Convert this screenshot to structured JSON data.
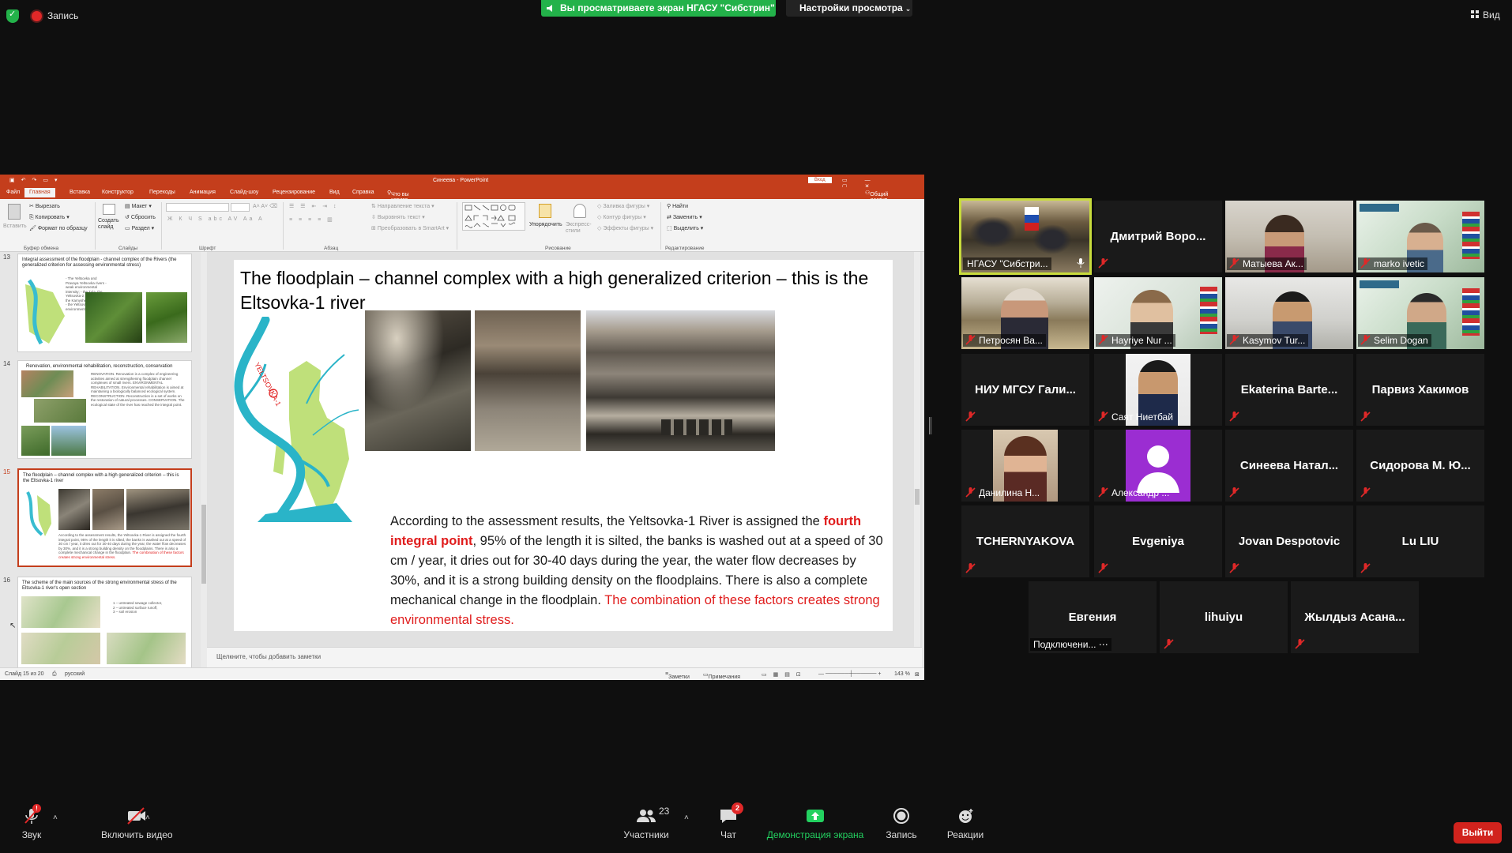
{
  "topbar": {
    "record_label": "Запись",
    "share_banner": "Вы просматриваете экран НГАСУ \"Сибстрин\"",
    "view_options": "Настройки просмотра",
    "view_button": "Вид"
  },
  "ppt": {
    "title": "Синеева - PowerPoint",
    "signin": "Вход",
    "tabs": [
      "Файл",
      "Главная",
      "Вставка",
      "Конструктор",
      "Переходы",
      "Анимация",
      "Слайд-шоу",
      "Рецензирование",
      "Вид",
      "Справка"
    ],
    "tell_me": "Что вы хотите сделать?",
    "share": "Общий доступ",
    "ribbon": {
      "paste": "Вставить",
      "cut": "Вырезать",
      "copy": "Копировать",
      "format_painter": "Формат по образцу",
      "clipboard": "Буфер обмена",
      "new_slide": "Создать слайд",
      "layout": "Макет",
      "reset": "Сбросить",
      "section": "Раздел",
      "slides": "Слайды",
      "font": "Шрифт",
      "paragraph": "Абзац",
      "text_direction": "Направление текста",
      "align_text": "Выровнять текст",
      "smartart": "Преобразовать в SmartArt",
      "arrange": "Упорядочить",
      "quick_styles": "Экспресс-стили",
      "shape_fill": "Заливка фигуры",
      "shape_outline": "Контур фигуры",
      "shape_effects": "Эффекты фигуры",
      "drawing": "Рисование",
      "find": "Найти",
      "replace": "Заменить",
      "select": "Выделить",
      "editing": "Редактирование"
    },
    "thumbnails": [
      {
        "num": "13",
        "title": "Integral assessment of the floodplain - channel complex of the Rivers (the generalized criterion for assessing environmental stress)",
        "text": "- The Yeltsovka and Pravaya Yeltsovka rivers - weak environmental intensity; - the Tula, the Yeltsovka-2, the Kamenka, the Kamyshenka - medium; - the Yeltsovka-1 - strong environmental intensity."
      },
      {
        "num": "14",
        "title": "Renovation, environmental rehabilitation, reconstruction, conservation",
        "text": "RENOVATION. Renovation is a complex of engineering activities aimed at strengthening floodplain channel complexes of small rivers. ENVIRONMENTAL REHABILITATION. Environmental rehabilitation is aimed at maintaining a biologically balanced ecological system. RECONSTRUCTION. Reconstruction is a set of works on the restoration of natural processes. CONSERVATION. The ecological state of the river has reached the integral point."
      },
      {
        "num": "15",
        "title": "The floodplain – channel complex with a high generalized criterion – this is the Eltsovka-1 river",
        "text": "According to the assessment results, the Yeltsovka-1 River is assigned the fourth integral point, 95% of the length it is silted, the banks is washed out at a speed of 30 cm / year, it dries out for 30-40 days during the year, the water flow decreases by 30%, and it is a strong building density on the floodplains. There is also a complete mechanical change in the floodplain.",
        "red": "The combination of these factors creates strong environmental stress."
      },
      {
        "num": "16",
        "title": "The scheme of the main sources of the strong environmental stress of the Eltsovka-1 river's open section",
        "legend": [
          "1 – untreated sewage collector,",
          "2 – untreated surface runoff,",
          "3 – soil erosion"
        ]
      }
    ],
    "slide": {
      "title": "The floodplain – channel complex with a high generalized criterion – this is the Eltsovka-1 river",
      "map_label": "YELTSOVKA-1",
      "body_1": "According to the assessment results, the Yeltsovka-1 River is assigned the ",
      "body_highlight": "fourth integral point",
      "body_2": ", 95% of the length it is silted, the banks is washed out at a speed of 30 cm / year, it dries out for 30-40 days during the year, the water flow decreases by 30%, and it is a strong building density on the floodplains. There is also a complete mechanical change in the floodplain. ",
      "body_red": "The combination of these factors creates strong environmental stress."
    },
    "notes_placeholder": "Щелкните, чтобы добавить заметки",
    "status": {
      "slide_counter": "Слайд 15 из 20",
      "language": "русский",
      "notes": "Заметки",
      "comments": "Примечания",
      "zoom": "143 %"
    }
  },
  "participants": [
    {
      "name": "НГАСУ \"Сибстри...",
      "has_video": true,
      "muted": false,
      "active": true,
      "label": true
    },
    {
      "name": "Дмитрий  Воро...",
      "has_video": false,
      "muted": true,
      "label": false
    },
    {
      "name": "Матыева Ак...",
      "has_video": true,
      "muted": true,
      "label": true
    },
    {
      "name": "marko ivetic",
      "has_video": true,
      "muted": true,
      "label": true
    },
    {
      "name": "Петросян Ва...",
      "has_video": true,
      "muted": true,
      "label": true
    },
    {
      "name": "Hayriye Nur ...",
      "has_video": true,
      "muted": true,
      "label": true
    },
    {
      "name": "Kasymov Tur...",
      "has_video": true,
      "muted": true,
      "label": true
    },
    {
      "name": "Selim Dogan",
      "has_video": true,
      "muted": true,
      "label": true
    },
    {
      "name": "НИУ  МГСУ Гали...",
      "has_video": false,
      "muted": true,
      "label": false
    },
    {
      "name": "Саят Ниетбай",
      "has_video": true,
      "muted": true,
      "label": true
    },
    {
      "name": "Ekaterina  Barte...",
      "has_video": false,
      "muted": true,
      "label": false
    },
    {
      "name": "Парвиз Хакимов",
      "has_video": false,
      "muted": true,
      "label": false
    },
    {
      "name": "Данилина Н...",
      "has_video": true,
      "muted": true,
      "label": true
    },
    {
      "name": "Александр ...",
      "has_video": true,
      "muted": true,
      "label": true,
      "avatar": true
    },
    {
      "name": "Синеева  Натал...",
      "has_video": false,
      "muted": true,
      "label": false
    },
    {
      "name": "Сидорова М. Ю...",
      "has_video": false,
      "muted": true,
      "label": false
    },
    {
      "name": "TCHERNYAKOVA",
      "has_video": false,
      "muted": true,
      "label": false
    },
    {
      "name": "Evgeniya",
      "has_video": false,
      "muted": true,
      "label": false
    },
    {
      "name": "Jovan Despotovic",
      "has_video": false,
      "muted": true,
      "label": false
    },
    {
      "name": "Lu LIU",
      "has_video": false,
      "muted": true,
      "label": false
    },
    {
      "name": "Евгения",
      "has_video": false,
      "muted": false,
      "label": false,
      "status": "Подключени..."
    },
    {
      "name": "lihuiyu",
      "has_video": false,
      "muted": true,
      "label": false
    },
    {
      "name": "Жылдыз  Асана...",
      "has_video": false,
      "muted": true,
      "label": false
    }
  ],
  "bottombar": {
    "audio": "Звук",
    "video": "Включить видео",
    "participants": "Участники",
    "participants_count": "23",
    "chat": "Чат",
    "chat_badge": "2",
    "share_screen": "Демонстрация экрана",
    "record": "Запись",
    "reactions": "Реакции",
    "leave": "Выйти"
  },
  "colors": {
    "zoom_green": "#23b24a",
    "ppt_accent": "#c43e1c",
    "active_speaker": "#c8dc3c",
    "mute_red": "#e02828",
    "slide_highlight_red": "#e01c1c"
  }
}
